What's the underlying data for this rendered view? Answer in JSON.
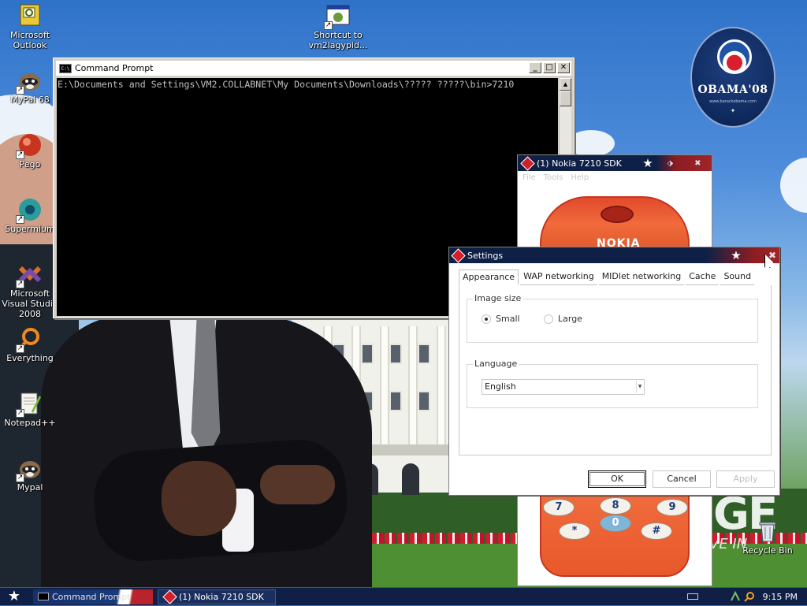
{
  "desktop": {
    "icons": [
      {
        "label": "Microsoft Outlook",
        "icon": "outlook-icon"
      },
      {
        "label": "Shortcut to vm2lagypid...",
        "icon": "shortcut-app-icon"
      },
      {
        "label": "MyPal 68",
        "icon": "raccoon-icon"
      },
      {
        "label": "Pego",
        "icon": "pego-icon"
      },
      {
        "label": "Supermium",
        "icon": "supermium-icon"
      },
      {
        "label": "Microsoft Visual Studio 2008",
        "icon": "visual-studio-icon"
      },
      {
        "label": "Everything",
        "icon": "everything-search-icon"
      },
      {
        "label": "Notepad++",
        "icon": "notepad-plus-plus-icon"
      },
      {
        "label": "Mypal",
        "icon": "raccoon-icon"
      },
      {
        "label": "Recycle Bin",
        "icon": "recycle-bin-icon"
      }
    ],
    "wallpaper": {
      "logo_text": "OBAMA'08",
      "logo_url": "www.barackobama.com",
      "logo_sub": "✦",
      "overlay_text_1": "GE",
      "overlay_text_2": "VE IN"
    }
  },
  "cmd_window": {
    "title": "Command Prompt",
    "icon_text": "C:\\",
    "buttons": {
      "minimize": "_",
      "maximize": "□",
      "close": "✕"
    },
    "console_text": "E:\\Documents and Settings\\VM2.COLLABNET\\My Documents\\Downloads\\????? ?????\\bin>7210"
  },
  "nokia_window": {
    "title": "(1) Nokia 7210 SDK",
    "menu": [
      "File",
      "Tools",
      "Help"
    ],
    "phone_brand": "NOKIA",
    "keys": [
      "7",
      "8",
      "9",
      "0",
      "*",
      "#"
    ]
  },
  "settings_dialog": {
    "title": "Settings",
    "tabs": [
      "Appearance",
      "WAP networking",
      "MIDlet networking",
      "Cache",
      "Sound"
    ],
    "active_tab": "Appearance",
    "image_size": {
      "legend": "Image size",
      "options": [
        "Small",
        "Large"
      ],
      "selected": "Small"
    },
    "language": {
      "legend": "Language",
      "value": "English"
    },
    "buttons": {
      "ok": "OK",
      "cancel": "Cancel",
      "apply": "Apply"
    }
  },
  "taskbar": {
    "start_icon": "star-icon",
    "tasks": [
      {
        "label": "Command Prompt"
      },
      {
        "label": "(1) Nokia 7210 SDK"
      }
    ],
    "clock": "9:15 PM"
  },
  "colors": {
    "titlebar_navy": "#0f2047",
    "titlebar_red": "#a1232a",
    "console_bg": "#000000",
    "console_fg": "#c0c0c0"
  }
}
